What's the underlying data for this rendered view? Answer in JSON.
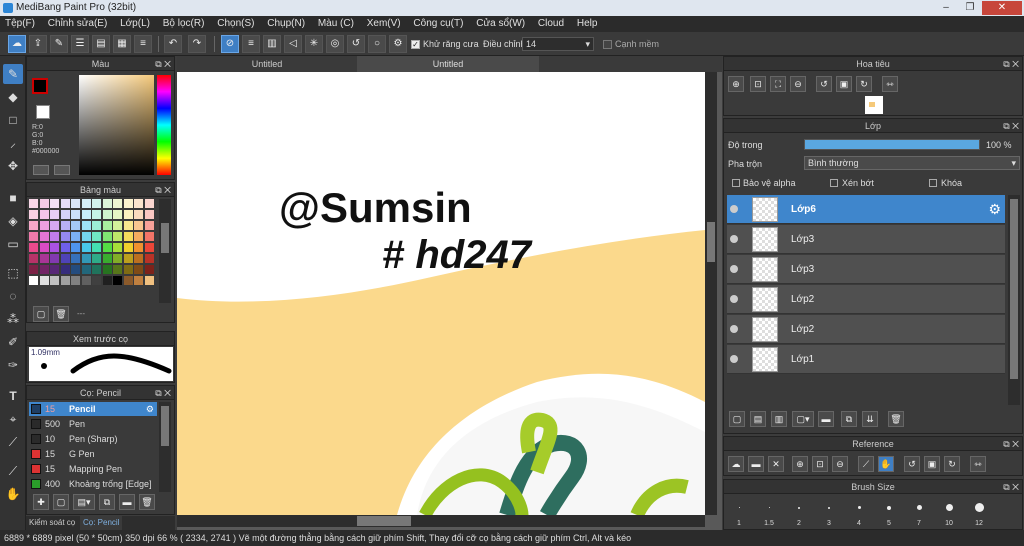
{
  "window": {
    "title": "MediBang Paint Pro (32bit)"
  },
  "menu": [
    "Tệp(F)",
    "Chỉnh sửa(E)",
    "Lớp(L)",
    "Bộ lọc(R)",
    "Chọn(S)",
    "Chụp(N)",
    "Màu (C)",
    "Xem(V)",
    "Công cụ(T)",
    "Cửa sổ(W)",
    "Cloud",
    "Help"
  ],
  "toolbar": {
    "antialias_label": "Khử răng cưa",
    "adjust_label": "Điều chỉnh",
    "adjust_value": "14",
    "smooth_label": "Cạnh mềm"
  },
  "color_panel": {
    "title": "Màu",
    "r": "R:0",
    "g": "G:0",
    "b": "B:0",
    "hex": "#000000"
  },
  "palette_panel": {
    "title": "Bảng màu",
    "extra": "---"
  },
  "brush_preview": {
    "title": "Xem trước cọ",
    "size": "1.09mm"
  },
  "brush_panel": {
    "title": "Cọ: Pencil",
    "items": [
      {
        "size": "15",
        "name": "Pencil",
        "color": "#1f3e63",
        "selected": true
      },
      {
        "size": "500",
        "name": "Pen",
        "color": "#2a2a2a",
        "selected": false
      },
      {
        "size": "10",
        "name": "Pen (Sharp)",
        "color": "#2a2a2a",
        "selected": false
      },
      {
        "size": "15",
        "name": "G Pen",
        "color": "#d33",
        "selected": false
      },
      {
        "size": "15",
        "name": "Mapping Pen",
        "color": "#d33",
        "selected": false
      },
      {
        "size": "400",
        "name": "Khoảng trống [Edge]",
        "color": "#2a9d2a",
        "selected": false
      }
    ],
    "tabs": [
      "Kiểm soát cọ",
      "Cọ: Pencil"
    ]
  },
  "doc_tabs": [
    "Untitled",
    "Untitled"
  ],
  "navigator": {
    "title": "Hoa tiêu"
  },
  "layer_panel": {
    "title": "Lớp",
    "opacity_label": "Độ trong",
    "opacity_value": "100 %",
    "opacity_fraction": 1.0,
    "blend_label": "Pha trộn",
    "blend_value": "Bình thường",
    "protect_alpha": "Bảo vệ alpha",
    "clipping": "Xén bớt",
    "lock": "Khóa",
    "layers": [
      {
        "name": "Lớp6",
        "selected": true
      },
      {
        "name": "Lớp3",
        "selected": false
      },
      {
        "name": "Lớp3",
        "selected": false
      },
      {
        "name": "Lớp2",
        "selected": false
      },
      {
        "name": "Lớp2",
        "selected": false
      },
      {
        "name": "Lớp1",
        "selected": false
      }
    ]
  },
  "reference_panel": {
    "title": "Reference"
  },
  "brush_size_panel": {
    "title": "Brush Size",
    "sizes": [
      "1",
      "1.5",
      "2",
      "3",
      "4",
      "5",
      "7",
      "10",
      "12"
    ]
  },
  "canvas": {
    "line1": "@Sumsin",
    "line2": "# hd247"
  },
  "status": {
    "text": "6889 * 6889 pixel  (50 * 50cm)  350 dpi  66 %  ( 2334, 2741 )  Vẽ một đường thẳng bằng cách giữ phím Shift, Thay đổi cỡ cọ bằng cách giữ phím Ctrl, Alt và kéo"
  }
}
